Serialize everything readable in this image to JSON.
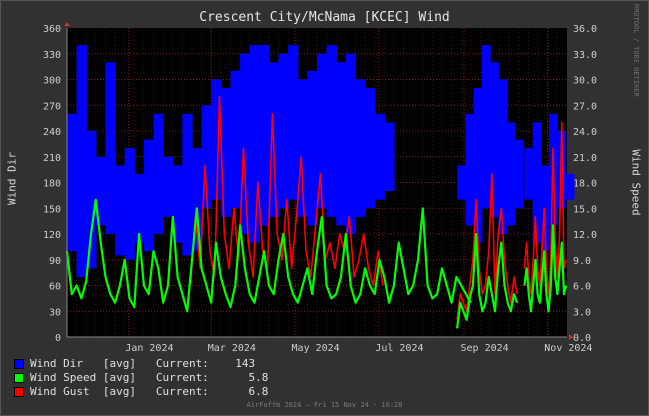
{
  "chart_data": {
    "type": "line",
    "title": "Crescent City/McNama [KCEC] Wind",
    "ylabel_left": "Wind Dir",
    "ylabel_right": "Wind Speed",
    "yleft_range": [
      0,
      360
    ],
    "yright_range": [
      0,
      36
    ],
    "yleft_ticks": [
      "0",
      "30",
      "60",
      "90",
      "120",
      "150",
      "180",
      "210",
      "240",
      "270",
      "300",
      "330",
      "360"
    ],
    "yright_ticks": [
      "0.0",
      "3.0",
      "6.0",
      "9.0",
      "12.0",
      "15.0",
      "18.0",
      "21.0",
      "24.0",
      "27.0",
      "30.0",
      "33.0",
      "36.0"
    ],
    "x_range": [
      "2023-11-17",
      "2024-11-15"
    ],
    "x_ticks": [
      {
        "label": "Jan 2024",
        "date": "2024-01-01"
      },
      {
        "label": "Mar 2024",
        "date": "2024-03-01"
      },
      {
        "label": "May 2024",
        "date": "2024-05-01"
      },
      {
        "label": "Jul 2024",
        "date": "2024-07-01"
      },
      {
        "label": "Sep 2024",
        "date": "2024-09-01"
      },
      {
        "label": "Nov 2024",
        "date": "2024-11-01"
      }
    ],
    "grid": true,
    "legend_placement": "bottom-left",
    "series": [
      {
        "name": "Wind Dir",
        "stat": "[avg]",
        "axis": "left",
        "color": "#0000ff",
        "current": "143",
        "note": "daily direction range (degrees)",
        "segments": [
          {
            "start": "2023-11-17",
            "step_days": 7,
            "low": [
              100,
              70,
              80,
              130,
              120,
              95,
              90,
              110,
              100,
              120,
              140,
              110,
              95,
              100,
              150,
              160,
              140,
              150,
              120,
              110,
              130,
              140,
              150,
              160,
              140,
              130,
              150,
              140,
              130,
              120,
              140,
              150,
              160,
              170
            ],
            "high": [
              260,
              340,
              240,
              210,
              320,
              200,
              220,
              190,
              230,
              260,
              210,
              200,
              260,
              220,
              270,
              300,
              290,
              310,
              330,
              340,
              340,
              320,
              330,
              340,
              300,
              310,
              330,
              340,
              320,
              330,
              300,
              290,
              260,
              250
            ]
          },
          {
            "start": "2024-08-27",
            "step_days": 6,
            "low": [
              160,
              130,
              110,
              150,
              140,
              120,
              130,
              150
            ],
            "high": [
              200,
              260,
              290,
              340,
              320,
              300,
              250,
              230
            ]
          },
          {
            "start": "2024-10-15",
            "step_days": 6,
            "low": [
              160,
              110,
              100,
              130,
              150,
              160
            ],
            "high": [
              220,
              250,
              200,
              260,
              240,
              190
            ]
          }
        ]
      },
      {
        "name": "Wind Speed",
        "stat": "[avg]",
        "axis": "right",
        "color": "#00ff00",
        "current": "5.8",
        "note": "daily average speed",
        "segments": [
          {
            "start": "2023-11-17",
            "step_days": 3.5,
            "values": [
              10,
              5,
              6,
              4.5,
              6.5,
              12,
              16,
              11,
              7,
              5,
              4,
              6,
              9,
              4.5,
              3.5,
              12,
              6,
              5,
              10,
              8,
              4,
              6,
              14,
              7,
              5,
              3,
              9,
              15,
              8,
              6,
              4,
              11,
              7,
              5,
              3.5,
              6,
              13,
              8,
              5,
              4,
              7,
              10,
              6,
              5,
              9,
              12,
              7,
              5,
              4,
              6,
              8,
              5,
              10,
              14,
              6,
              4.5,
              5,
              7,
              12,
              6,
              4,
              5,
              8,
              6,
              5,
              9,
              7,
              4,
              6,
              11,
              8,
              5,
              6,
              9,
              15,
              6,
              4.5,
              5,
              8,
              6,
              4,
              7,
              6,
              5,
              4
            ]
          },
          {
            "start": "2024-08-27",
            "step_days": 2.3,
            "values": [
              1,
              4,
              3,
              2,
              4.5,
              6,
              12,
              5,
              3,
              4,
              7,
              5,
              3,
              8,
              11,
              6,
              4,
              3,
              5,
              4
            ]
          },
          {
            "start": "2024-10-15",
            "step_days": 1.6,
            "values": [
              6,
              8,
              5,
              3,
              6,
              9,
              5,
              4,
              7,
              10,
              5,
              3,
              6,
              13,
              7,
              5,
              8,
              11,
              5,
              6
            ]
          }
        ]
      },
      {
        "name": "Wind Gust",
        "stat": "[avg]",
        "axis": "right",
        "color": "#ff0000",
        "current": "6.8",
        "note": "daily average gust",
        "segments": [
          {
            "start": "2024-02-15",
            "step_days": 3.5,
            "values": [
              6,
              14,
              8,
              20,
              10,
              7,
              28,
              12,
              8,
              15,
              9,
              22,
              11,
              7,
              18,
              10,
              8,
              26,
              12,
              9,
              16,
              8,
              14,
              21,
              10,
              7,
              13,
              19,
              9,
              11,
              8,
              12,
              10,
              14,
              7,
              9,
              12,
              8,
              6,
              10,
              6
            ]
          },
          {
            "start": "2024-08-27",
            "step_days": 2.3,
            "values": [
              2,
              5,
              4,
              3,
              6,
              9,
              16,
              8,
              5,
              6,
              10,
              19,
              5,
              12,
              15,
              9,
              6,
              4,
              7,
              5
            ]
          },
          {
            "start": "2024-10-15",
            "step_days": 1.6,
            "values": [
              8,
              11,
              7,
              5,
              9,
              14,
              8,
              6,
              10,
              15,
              8,
              5,
              9,
              22,
              11,
              7,
              12,
              25,
              8,
              9
            ]
          }
        ]
      }
    ]
  },
  "legend": {
    "items": [
      {
        "label": "Wind Dir   [avg]   Current:    143",
        "color": "#0000ff"
      },
      {
        "label": "Wind Speed [avg]   Current:      5.8",
        "color": "#00ff00"
      },
      {
        "label": "Wind Gust  [avg]   Current:      6.8",
        "color": "#ff0000"
      }
    ]
  },
  "watermark": "RRDTOOL / TOBI OETIKER",
  "footer": "AirFuffm 2024 – Fri 15 Nov 24 - 16:28"
}
